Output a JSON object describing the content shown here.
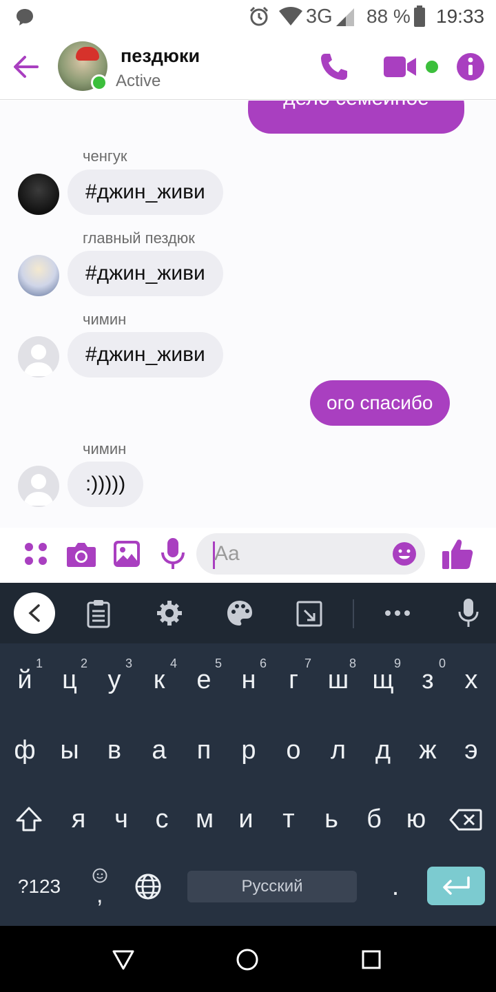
{
  "status_bar": {
    "network": "3G",
    "battery": "88 %",
    "time": "19:33"
  },
  "header": {
    "title": "пездюки",
    "status": "Active"
  },
  "conversation": {
    "partial_message": "дело семейное",
    "messages": [
      {
        "sender": "ченгук",
        "text": "#джин_живи"
      },
      {
        "sender": "главный пездюк",
        "text": "#джин_живи"
      },
      {
        "sender": "чимин",
        "text": "#джин_живи"
      },
      {
        "sender": "",
        "text": "ого спасибо"
      },
      {
        "sender": "чимин",
        "text": ":)))))"
      }
    ]
  },
  "composer": {
    "placeholder": "Aa"
  },
  "keyboard": {
    "row1": [
      {
        "key": "й",
        "hint": "1"
      },
      {
        "key": "ц",
        "hint": "2"
      },
      {
        "key": "у",
        "hint": "3"
      },
      {
        "key": "к",
        "hint": "4"
      },
      {
        "key": "е",
        "hint": "5"
      },
      {
        "key": "н",
        "hint": "6"
      },
      {
        "key": "г",
        "hint": "7"
      },
      {
        "key": "ш",
        "hint": "8"
      },
      {
        "key": "щ",
        "hint": "9"
      },
      {
        "key": "з",
        "hint": "0"
      },
      {
        "key": "х",
        "hint": ""
      }
    ],
    "row2": [
      "ф",
      "ы",
      "в",
      "а",
      "п",
      "р",
      "о",
      "л",
      "д",
      "ж",
      "э"
    ],
    "row3": [
      "я",
      "ч",
      "с",
      "м",
      "и",
      "т",
      "ь",
      "б",
      "ю"
    ],
    "symbols_label": "?123",
    "comma": ",",
    "space_label": "Русский",
    "period": "."
  },
  "colors": {
    "accent": "#a93fc0",
    "online": "#3cbf3c",
    "keyboard_bg": "#263140",
    "enter_key": "#7ccbd0"
  }
}
